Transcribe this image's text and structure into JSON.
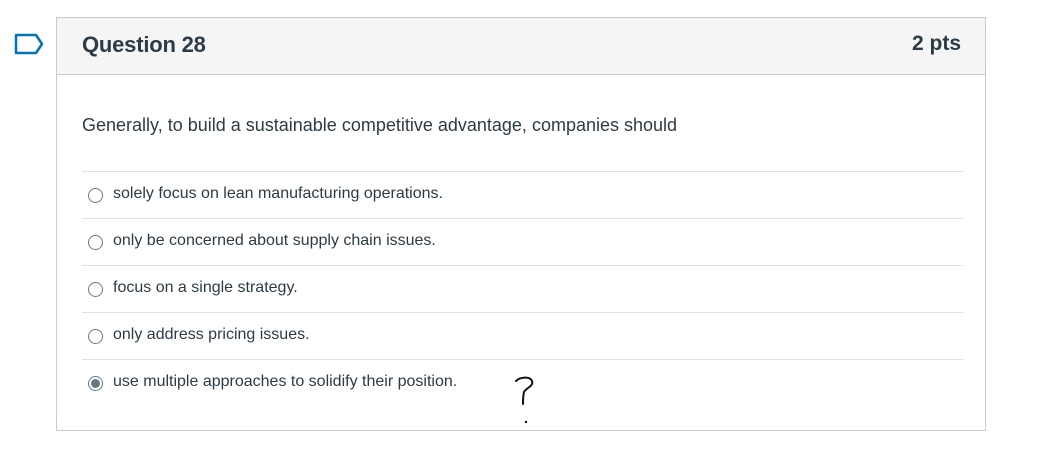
{
  "question": {
    "title": "Question 28",
    "points": "2 pts",
    "text": "Generally, to build a sustainable competitive advantage, companies should",
    "flag_icon": "flag-outline-icon",
    "accent_color": "#0374b5"
  },
  "answers": [
    {
      "label": "solely focus on lean manufacturing operations.",
      "selected": false
    },
    {
      "label": "only be concerned about supply chain issues.",
      "selected": false
    },
    {
      "label": "focus on a single strategy.",
      "selected": false
    },
    {
      "label": "only address pricing issues.",
      "selected": false
    },
    {
      "label": "use multiple approaches to solidify their position.",
      "selected": true
    }
  ]
}
